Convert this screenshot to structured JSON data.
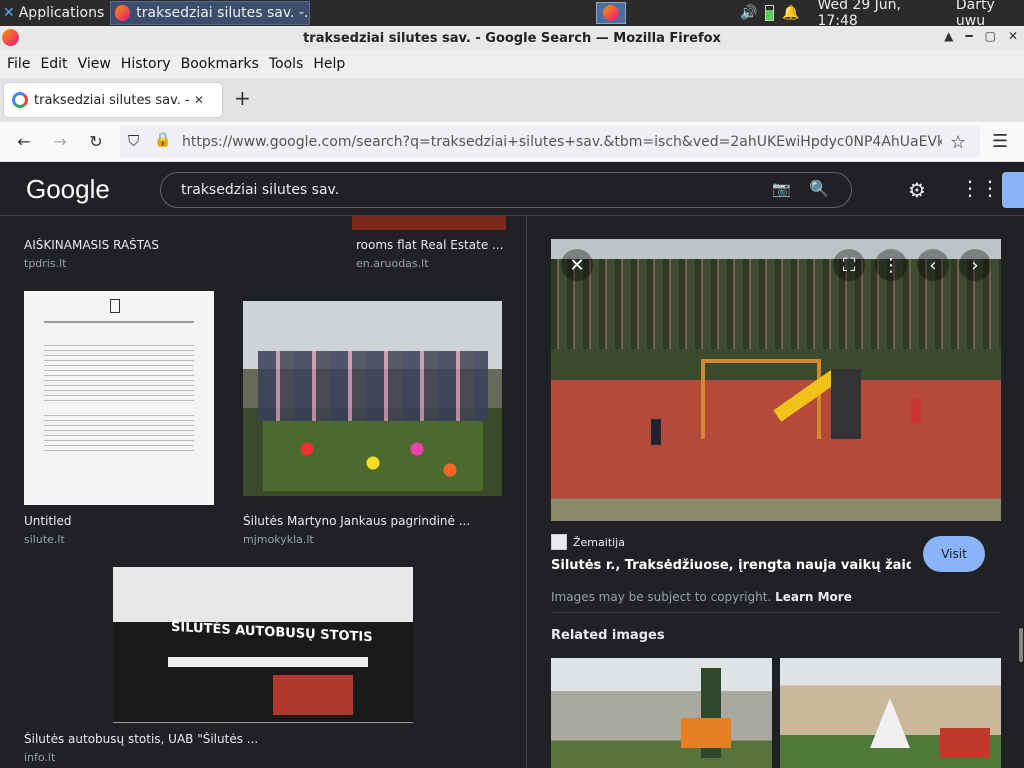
{
  "taskbar": {
    "applications_label": "Applications",
    "task_title": "traksedziai silutes sav. -...",
    "datetime": "Wed 29 Jun, 17:48",
    "user": "Darty uwu"
  },
  "window": {
    "title": "traksedziai silutes sav. - Google Search — Mozilla Firefox"
  },
  "menu": [
    "File",
    "Edit",
    "View",
    "History",
    "Bookmarks",
    "Tools",
    "Help"
  ],
  "tab": {
    "title": "traksedziai silutes sav. - Go"
  },
  "url": "https://www.google.com/search?q=traksedziai+silutes+sav.&tbm=isch&ved=2ahUKEwiHpdyc0NP4AhUaEVk",
  "google": {
    "logo": "Google",
    "query": "traksedziai silutes sav."
  },
  "results": [
    {
      "title": "AIŠKINAMASIS RAŠTAS",
      "source": "tpdris.lt"
    },
    {
      "title": "rooms flat Real Estate ...",
      "source": "en.aruodas.lt"
    },
    {
      "title": "Untitled",
      "source": "silute.lt"
    },
    {
      "title": "Šilutės Martyno Jankaus pagrindinė ...",
      "source": "mjmokykla.lt"
    },
    {
      "title": "Šilutės autobusų stotis, UAB \"Šilutės ...",
      "source": "info.lt"
    }
  ],
  "station_sign": "ŠILUTĖS AUTOBUSŲ STOTIS",
  "panel": {
    "source": "Žemaitija",
    "title": "Šilutės r., Traksėdžiuose, įrengta nauja vaikų žaidim...",
    "visit_label": "Visit",
    "copyright": "Images may be subject to copyright.",
    "learn_more": "Learn More",
    "related_label": "Related images"
  },
  "colors": {
    "accent": "#8ab4f8",
    "background": "#202124"
  }
}
